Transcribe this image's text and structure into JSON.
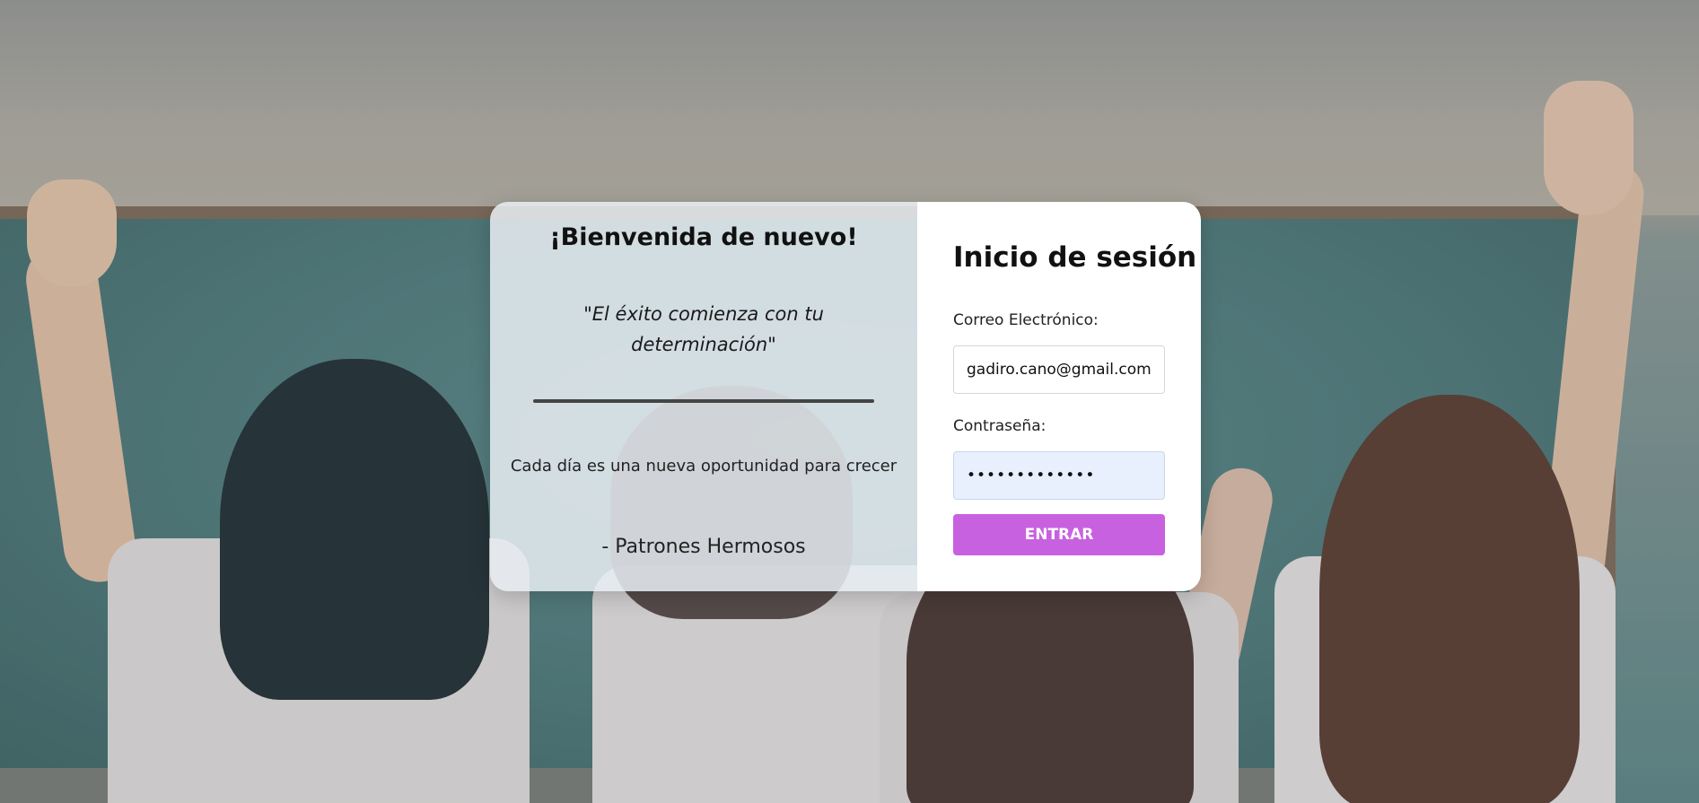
{
  "welcome": {
    "title": "¡Bienvenida de nuevo!",
    "quote": "\"El éxito comienza con tu determinación\"",
    "tagline": "Cada día es una nueva oportunidad para crecer",
    "signature": "- Patrones Hermosos"
  },
  "login": {
    "title": "Inicio de sesión",
    "email_label": "Correo Electrónico:",
    "email_value": "gadiro.cano@gmail.com",
    "password_label": "Contraseña:",
    "password_value": "•••••••••••••",
    "submit_label": "ENTRAR"
  },
  "colors": {
    "button": "#c861e0",
    "password_field_bg": "#e8f0fe"
  }
}
